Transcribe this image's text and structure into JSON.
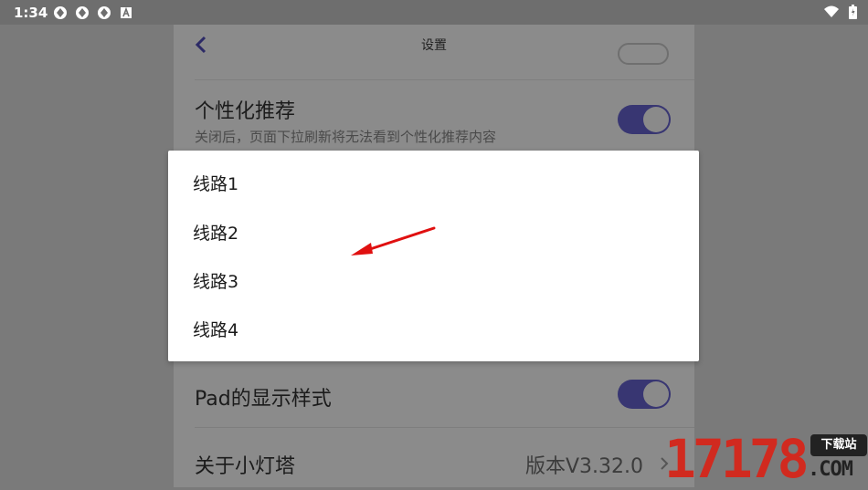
{
  "status_bar": {
    "time": "1:34",
    "notification_icons": [
      "aperture-icon",
      "aperture-icon",
      "aperture-icon",
      "letter-a-icon"
    ],
    "right_icons": [
      "wifi-icon",
      "battery-icon"
    ]
  },
  "header": {
    "title": "设置",
    "back_icon": "chevron-left-icon"
  },
  "settings": {
    "personalized": {
      "title": "个性化推荐",
      "description": "关闭后，页面下拉刷新将无法看到个性化推荐内容",
      "enabled": true
    },
    "pad_display": {
      "title": "Pad的显示样式",
      "enabled": true
    },
    "about": {
      "title": "关于小灯塔",
      "value": "版本V3.32.0"
    }
  },
  "dialog": {
    "options": [
      "线路1",
      "线路2",
      "线路3",
      "线路4"
    ]
  },
  "watermark": {
    "number": "17178",
    "label": "下载站",
    "domain": ".COM"
  },
  "colors": {
    "toggle_on": "#383672",
    "accent": "#5b56c8",
    "annotation_arrow": "#e01010",
    "watermark_red": "#d12a1f"
  }
}
